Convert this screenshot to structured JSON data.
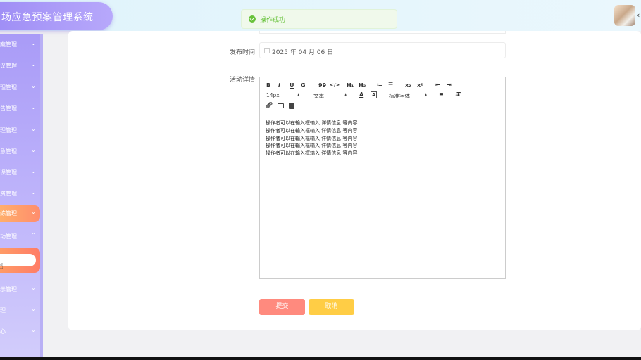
{
  "app": {
    "title": "场应急预案管理系统"
  },
  "toast": {
    "message": "操作成功"
  },
  "sidebar": {
    "items": [
      {
        "label": "案管理"
      },
      {
        "label": "议管理"
      },
      {
        "label": "理管理"
      },
      {
        "label": "告管理"
      },
      {
        "label": "理管理"
      },
      {
        "label": "急管理"
      },
      {
        "label": "课管理"
      },
      {
        "label": "资管理"
      },
      {
        "label": "练管理"
      },
      {
        "label": "动管理"
      },
      {
        "label": "示管理"
      },
      {
        "label": "理"
      },
      {
        "label": "心"
      }
    ]
  },
  "form": {
    "publish_time_label": "发布时间",
    "publish_time_value": "2025 年 04 月 06 日",
    "detail_label": "活动详情"
  },
  "editor": {
    "toolbar": {
      "bold": "B",
      "italic": "I",
      "underline": "U",
      "strike": "G",
      "quote": "99",
      "code": "</>",
      "h1": "H₁",
      "h2": "H₂",
      "ordered_list": "≔",
      "bullet_list": "☰",
      "subscript": "x₂",
      "superscript": "x²",
      "outdent": "⇤",
      "indent": "⇥",
      "font_size": "14px",
      "header_select": "文本",
      "font_family": "标准字体"
    },
    "lines": [
      "操作者可以在输入框输入  详情信息  等内容",
      "操作者可以在输入框输入  详情信息  等内容",
      "操作者可以在输入框输入  详情信息  等内容",
      "操作者可以在输入框输入  详情信息  等内容",
      "操作者可以在输入框输入  详情信息  等内容"
    ]
  },
  "buttons": {
    "submit": "提交",
    "cancel": "取消"
  }
}
